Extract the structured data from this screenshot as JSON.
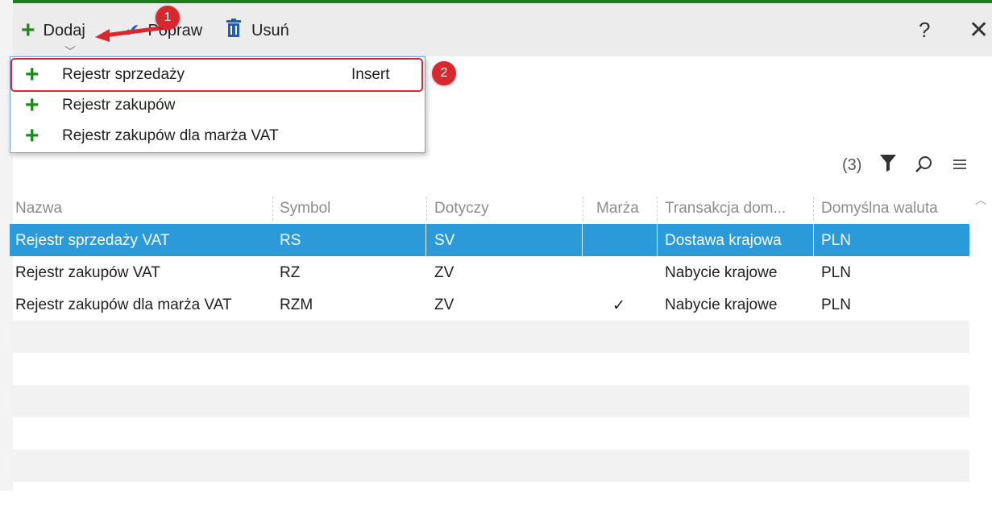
{
  "toolbar": {
    "add_label": "Dodaj",
    "edit_label": "Popraw",
    "delete_label": "Usuń",
    "help_label": "?",
    "close_label": "✕"
  },
  "add_menu": {
    "items": [
      {
        "label": "Rejestr sprzedaży",
        "shortcut": "Insert"
      },
      {
        "label": "Rejestr zakupów",
        "shortcut": ""
      },
      {
        "label": "Rejestr zakupów dla marża VAT",
        "shortcut": ""
      }
    ]
  },
  "annotations": {
    "badge1": "1",
    "badge2": "2"
  },
  "grid": {
    "count": "(3)",
    "columns": [
      "Nazwa",
      "Symbol",
      "Dotyczy",
      "Marża",
      "Transakcja dom...",
      "Domyślna waluta"
    ],
    "rows": [
      {
        "nazwa": "Rejestr sprzedaży VAT",
        "symbol": "RS",
        "dotyczy": "SV",
        "marza": "",
        "transakcja": "Dostawa krajowa",
        "waluta": "PLN"
      },
      {
        "nazwa": "Rejestr zakupów VAT",
        "symbol": "RZ",
        "dotyczy": "ZV",
        "marza": "",
        "transakcja": "Nabycie krajowe",
        "waluta": "PLN"
      },
      {
        "nazwa": "Rejestr zakupów dla marża VAT",
        "symbol": "RZM",
        "dotyczy": "ZV",
        "marza": "✓",
        "transakcja": "Nabycie krajowe",
        "waluta": "PLN"
      }
    ]
  },
  "colors": {
    "accent": "#1e7b1e",
    "selection": "#2a9ad8",
    "annotation": "#d7282f",
    "icon_blue": "#1e5fb4"
  },
  "icons": [
    "plus-icon",
    "pencil-icon",
    "trash-icon",
    "help-icon",
    "close-icon",
    "filter-icon",
    "search-icon",
    "menu-icon",
    "checkmark-icon"
  ]
}
